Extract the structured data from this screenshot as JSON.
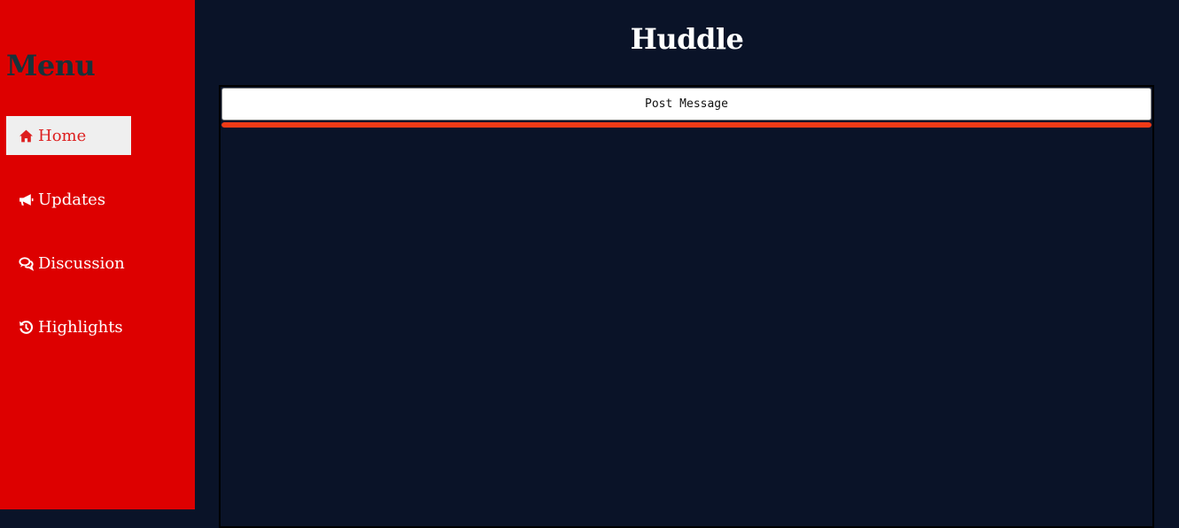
{
  "sidebar": {
    "title": "Menu",
    "items": [
      {
        "label": "Home",
        "icon": "home-icon",
        "active": true
      },
      {
        "label": "Updates",
        "icon": "bullhorn-icon",
        "active": false
      },
      {
        "label": "Discussion",
        "icon": "comments-icon",
        "active": false
      },
      {
        "label": "Highlights",
        "icon": "history-icon",
        "active": false
      }
    ]
  },
  "header": {
    "title": "Huddle"
  },
  "main": {
    "post_button_label": "Post Message",
    "progress": 1.0
  },
  "colors": {
    "sidebar_bg": "#dd0000",
    "page_bg": "#0a1328",
    "menu_title": "#17323a",
    "active_item_bg": "#efefef",
    "active_item_text": "#dd1f1f",
    "progress_bar": "#f03a17"
  }
}
